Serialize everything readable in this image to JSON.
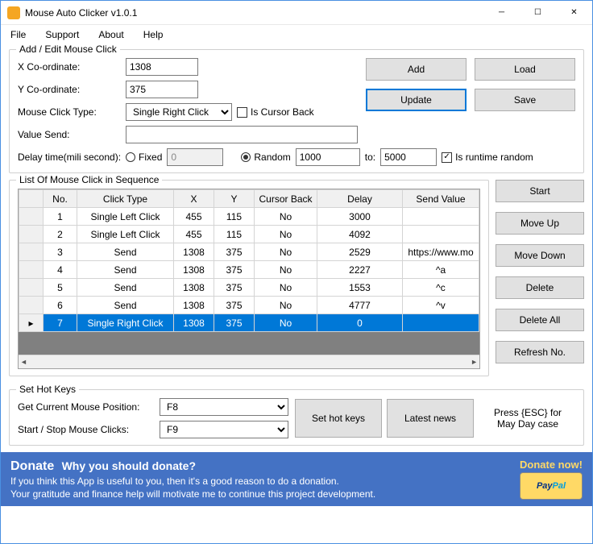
{
  "window": {
    "title": "Mouse Auto Clicker v1.0.1"
  },
  "menu": {
    "file": "File",
    "support": "Support",
    "about": "About",
    "help": "Help"
  },
  "addEdit": {
    "legend": "Add / Edit Mouse Click",
    "xLabel": "X Co-ordinate:",
    "xValue": "1308",
    "yLabel": "Y Co-ordinate:",
    "yValue": "375",
    "clickTypeLabel": "Mouse Click Type:",
    "clickType": "Single Right Click",
    "isCursorBack": "Is Cursor Back",
    "valueSendLabel": "Value Send:",
    "valueSend": "",
    "delayLabel": "Delay time(mili second):",
    "fixed": "Fixed",
    "fixedValue": "0",
    "random": "Random",
    "randomFrom": "1000",
    "toLabel": "to:",
    "randomTo": "5000",
    "isRuntimeRandom": "Is runtime random",
    "addBtn": "Add",
    "updateBtn": "Update",
    "loadBtn": "Load",
    "saveBtn": "Save"
  },
  "list": {
    "legend": "List Of Mouse Click in Sequence",
    "headers": {
      "no": "No.",
      "clickType": "Click Type",
      "x": "X",
      "y": "Y",
      "cursorBack": "Cursor Back",
      "delay": "Delay",
      "sendValue": "Send Value"
    },
    "rows": [
      {
        "no": "1",
        "clickType": "Single Left Click",
        "x": "455",
        "y": "115",
        "cursorBack": "No",
        "delay": "3000",
        "sendValue": ""
      },
      {
        "no": "2",
        "clickType": "Single Left Click",
        "x": "455",
        "y": "115",
        "cursorBack": "No",
        "delay": "4092",
        "sendValue": ""
      },
      {
        "no": "3",
        "clickType": "Send",
        "x": "1308",
        "y": "375",
        "cursorBack": "No",
        "delay": "2529",
        "sendValue": "https://www.mo"
      },
      {
        "no": "4",
        "clickType": "Send",
        "x": "1308",
        "y": "375",
        "cursorBack": "No",
        "delay": "2227",
        "sendValue": "^a"
      },
      {
        "no": "5",
        "clickType": "Send",
        "x": "1308",
        "y": "375",
        "cursorBack": "No",
        "delay": "1553",
        "sendValue": "^c"
      },
      {
        "no": "6",
        "clickType": "Send",
        "x": "1308",
        "y": "375",
        "cursorBack": "No",
        "delay": "4777",
        "sendValue": "^v"
      },
      {
        "no": "7",
        "clickType": "Single Right Click",
        "x": "1308",
        "y": "375",
        "cursorBack": "No",
        "delay": "0",
        "sendValue": "",
        "selected": true
      }
    ],
    "sideButtons": {
      "start": "Start",
      "moveUp": "Move Up",
      "moveDown": "Move Down",
      "delete": "Delete",
      "deleteAll": "Delete All",
      "refresh": "Refresh No."
    }
  },
  "hotkeys": {
    "legend": "Set Hot Keys",
    "getPosLabel": "Get Current Mouse Position:",
    "getPosKey": "F8",
    "startStopLabel": "Start / Stop Mouse Clicks:",
    "startStopKey": "F9",
    "setBtn": "Set hot keys",
    "newsBtn": "Latest news",
    "escNote": "Press {ESC} for May Day case"
  },
  "donate": {
    "title": "Donate",
    "subtitle": "Why you should donate?",
    "line1": "If you think this App is useful to you, then it's a good reason to do a donation.",
    "line2": "Your gratitude and finance help will motivate me to continue this project development.",
    "now": "Donate now!",
    "paypal1": "Pay",
    "paypal2": "Pal"
  }
}
